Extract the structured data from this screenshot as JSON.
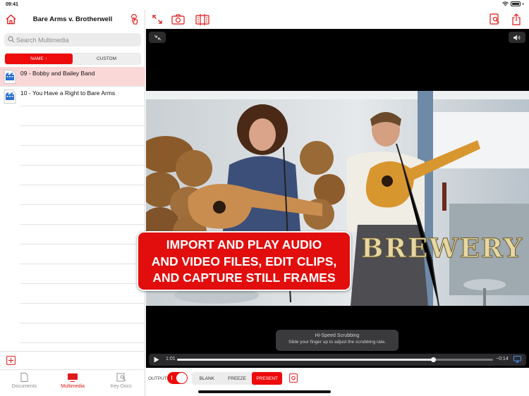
{
  "status": {
    "time": "09:41"
  },
  "sidebar": {
    "title": "Bare Arms v. Brotherwell",
    "search_placeholder": "Search Multimedia",
    "sort": {
      "name_label": "NAME ↑",
      "custom_label": "CUSTOM",
      "active": "name"
    },
    "files": [
      {
        "name": "09 - Bobby and Bailey Band",
        "selected": true
      },
      {
        "name": "10 - You Have a Right to Bare Arms",
        "selected": false
      }
    ],
    "tabs": [
      {
        "label": "Documents",
        "active": false
      },
      {
        "label": "Multimedia",
        "active": true
      },
      {
        "label": "Key Docs",
        "active": false
      }
    ]
  },
  "player": {
    "overlay_text": "BREWERY",
    "scrub_title": "Hi-Speed Scrubbing",
    "scrub_text": "Slide your finger up to adjust the scrubbing rate.",
    "current_time": "1:01",
    "remaining_time": "−0:14",
    "progress": 0.81
  },
  "output": {
    "label": "OUTPUT",
    "enabled": true,
    "modes": [
      "BLANK",
      "FREEZE",
      "PRESENT"
    ],
    "active_mode": "PRESENT"
  },
  "promo": {
    "line1": "IMPORT AND PLAY AUDIO",
    "line2": "AND VIDEO FILES, EDIT CLIPS,",
    "line3": "AND CAPTURE STILL FRAMES"
  },
  "colors": {
    "accent": "#e0191a",
    "selected_row": "#fbd8d8"
  }
}
